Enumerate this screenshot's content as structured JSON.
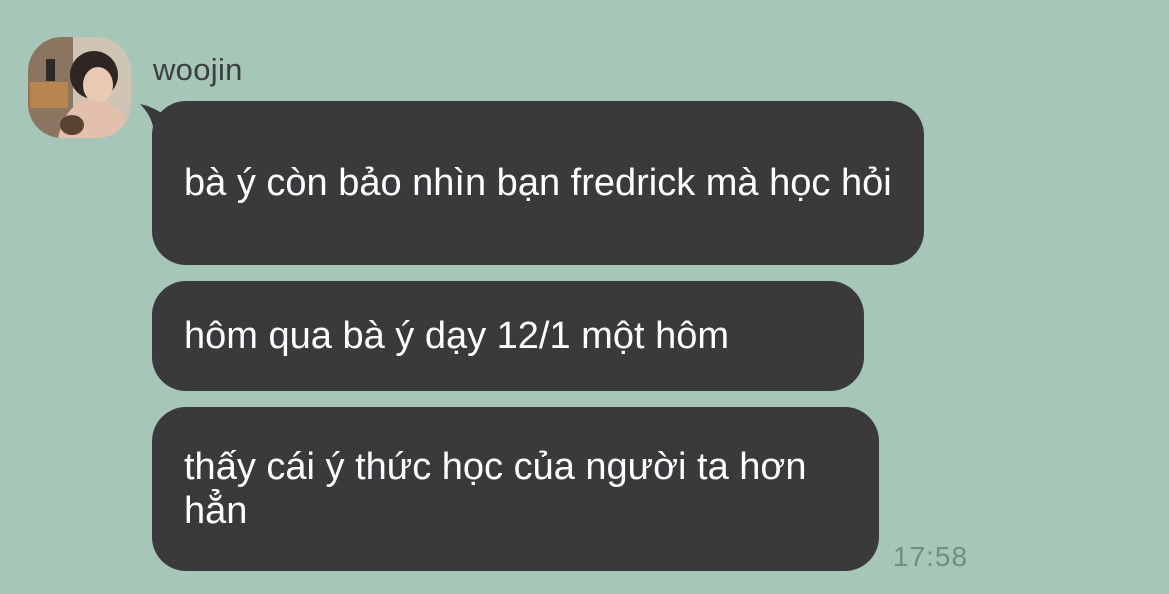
{
  "sender": {
    "name": "woojin",
    "avatar_icon": "profile-photo"
  },
  "messages": [
    {
      "text": "bà ý còn bảo nhìn bạn fredrick mà học hỏi"
    },
    {
      "text": "hôm qua bà ý dạy 12/1 một hôm"
    },
    {
      "text": "thấy cái ý thức học của người ta hơn hẳn"
    }
  ],
  "timestamp": "17:58",
  "colors": {
    "background": "#a6c6b7",
    "bubble": "#3a3a3c",
    "bubble_text": "#ffffff",
    "timestamp": "#6f8f82"
  }
}
